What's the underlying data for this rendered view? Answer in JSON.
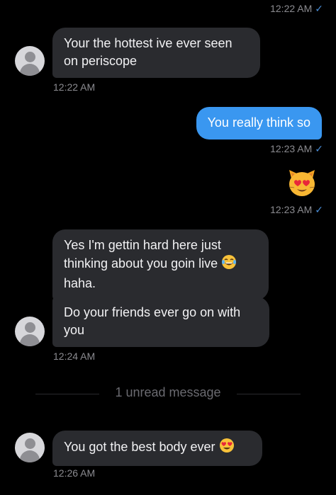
{
  "colors": {
    "background": "#000000",
    "incoming_bubble": "#2a2b2f",
    "outgoing_bubble": "#3a97f0",
    "timestamp": "#8b8b90",
    "read_check": "#4a8ed8"
  },
  "messages": {
    "top_timestamp": "12:22 AM",
    "m1": {
      "text": "Your the hottest ive ever seen on periscope",
      "time": "12:22 AM"
    },
    "m2": {
      "text": "You really think so",
      "time": "12:23 AM"
    },
    "m3": {
      "emoji": "smiling-cat-heart-eyes-emoji",
      "time": "12:23 AM"
    },
    "m4": {
      "text": "Yes I'm gettin hard here just thinking about you goin live",
      "text_end": "haha.",
      "emoji": "tears-of-joy-emoji"
    },
    "m5": {
      "text": "Do your friends ever go on with you",
      "time": "12:24 AM"
    },
    "unread_divider": "1 unread message",
    "m6": {
      "text": "You got the best body ever",
      "emoji": "heart-eyes-emoji",
      "time": "12:26 AM"
    }
  },
  "icons": {
    "read_receipt": "check-icon",
    "avatar": "default-avatar-icon"
  }
}
